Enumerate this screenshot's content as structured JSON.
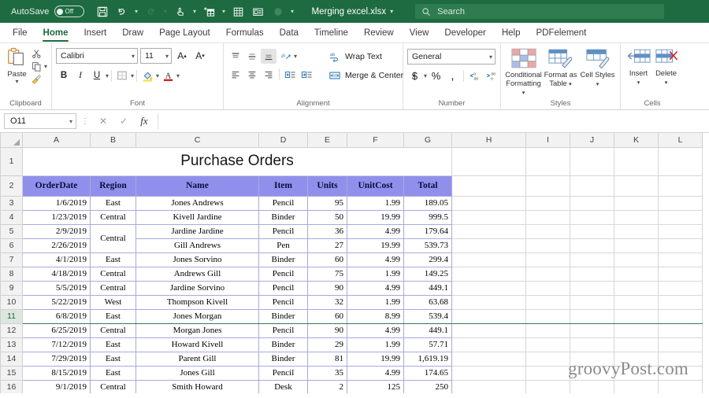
{
  "titlebar": {
    "autosave_label": "AutoSave",
    "autosave_state": "Off",
    "filename": "Merging excel.xlsx",
    "quick_access": [
      {
        "name": "save-icon"
      },
      {
        "name": "undo-icon"
      },
      {
        "name": "redo-icon"
      },
      {
        "name": "touch-mode-icon"
      },
      {
        "name": "new-table-icon"
      },
      {
        "name": "table-grid-icon"
      },
      {
        "name": "card-view-icon"
      },
      {
        "name": "record-icon"
      },
      {
        "name": "customize-toolbar-icon"
      }
    ]
  },
  "search": {
    "placeholder": "Search",
    "icon": "search-icon"
  },
  "tabs": [
    {
      "label": "File",
      "active": false
    },
    {
      "label": "Home",
      "active": true
    },
    {
      "label": "Insert",
      "active": false
    },
    {
      "label": "Draw",
      "active": false
    },
    {
      "label": "Page Layout",
      "active": false
    },
    {
      "label": "Formulas",
      "active": false
    },
    {
      "label": "Data",
      "active": false
    },
    {
      "label": "Timeline",
      "active": false
    },
    {
      "label": "Review",
      "active": false
    },
    {
      "label": "View",
      "active": false
    },
    {
      "label": "Developer",
      "active": false
    },
    {
      "label": "Help",
      "active": false
    },
    {
      "label": "PDFelement",
      "active": false
    }
  ],
  "ribbon": {
    "clipboard": {
      "group_label": "Clipboard",
      "paste_label": "Paste",
      "cut_icon": "scissors-icon",
      "copy_icon": "copy-icon",
      "format_painter_icon": "format-painter-icon"
    },
    "font": {
      "group_label": "Font",
      "font_name": "Calibri",
      "font_size": "11",
      "grow_font": "A",
      "shrink_font": "A",
      "bold": "B",
      "italic": "I",
      "underline": "U",
      "borders_icon": "borders-icon",
      "fill_color_icon": "fill-color-icon",
      "font_color_icon": "font-color-icon"
    },
    "alignment": {
      "group_label": "Alignment",
      "wrap_text_label": "Wrap Text",
      "merge_center_label": "Merge & Center",
      "orientation_icon": "orientation-icon",
      "wrap_text_icon": "wrap-text-icon",
      "merge_center_icon": "merge-center-icon"
    },
    "number": {
      "group_label": "Number",
      "format": "General",
      "currency": "$",
      "percent": "%",
      "comma": ",",
      "increase_decimal_icon": "increase-decimal-icon",
      "decrease_decimal_icon": "decrease-decimal-icon"
    },
    "styles": {
      "group_label": "Styles",
      "conditional_formatting": "Conditional Formatting",
      "format_as_table": "Format as Table",
      "cell_styles": "Cell Styles"
    },
    "cells": {
      "group_label": "Cells",
      "insert": "Insert",
      "delete": "Delete"
    }
  },
  "formula_bar": {
    "name_box": "O11",
    "cancel_icon": "cancel-icon",
    "confirm_icon": "confirm-icon",
    "function_icon": "fx",
    "formula_value": ""
  },
  "grid": {
    "columns": [
      "A",
      "B",
      "C",
      "D",
      "E",
      "F",
      "G",
      "H",
      "I",
      "J",
      "K",
      "L"
    ],
    "rows": [
      "1",
      "2",
      "3",
      "4",
      "5",
      "6",
      "7",
      "8",
      "9",
      "10",
      "11",
      "12",
      "13",
      "14",
      "15",
      "16"
    ],
    "active_row": "11",
    "title": "Purchase Orders",
    "headers": [
      "OrderDate",
      "Region",
      "Name",
      "Item",
      "Units",
      "UnitCost",
      "Total"
    ],
    "header_bg": "#9090EC",
    "data": [
      {
        "row": "3",
        "date": "1/6/2019",
        "region": "East",
        "name": "Jones Andrews",
        "item": "Pencil",
        "units": "95",
        "unitcost": "1.99",
        "total": "189.05"
      },
      {
        "row": "4",
        "date": "1/23/2019",
        "region": "Central",
        "name": "Kivell Jardine",
        "item": "Binder",
        "units": "50",
        "unitcost": "19.99",
        "total": "999.5"
      },
      {
        "row": "5",
        "date": "2/9/2019",
        "region": "Central",
        "name": "Jardine Jardine",
        "item": "Pencil",
        "units": "36",
        "unitcost": "4.99",
        "total": "179.64"
      },
      {
        "row": "6",
        "date": "2/26/2019",
        "region": "",
        "name": "Gill Andrews",
        "item": "Pen",
        "units": "27",
        "unitcost": "19.99",
        "total": "539.73"
      },
      {
        "row": "7",
        "date": "4/1/2019",
        "region": "East",
        "name": "Jones Sorvino",
        "item": "Binder",
        "units": "60",
        "unitcost": "4.99",
        "total": "299.4"
      },
      {
        "row": "8",
        "date": "4/18/2019",
        "region": "Central",
        "name": "Andrews Gill",
        "item": "Pencil",
        "units": "75",
        "unitcost": "1.99",
        "total": "149.25"
      },
      {
        "row": "9",
        "date": "5/5/2019",
        "region": "Central",
        "name": "Jardine Sorvino",
        "item": "Pencil",
        "units": "90",
        "unitcost": "4.99",
        "total": "449.1"
      },
      {
        "row": "10",
        "date": "5/22/2019",
        "region": "West",
        "name": "Thompson Kivell",
        "item": "Pencil",
        "units": "32",
        "unitcost": "1.99",
        "total": "63.68"
      },
      {
        "row": "11",
        "date": "6/8/2019",
        "region": "East",
        "name": "Jones Morgan",
        "item": "Binder",
        "units": "60",
        "unitcost": "8.99",
        "total": "539.4"
      },
      {
        "row": "12",
        "date": "6/25/2019",
        "region": "Central",
        "name": "Morgan Jones",
        "item": "Pencil",
        "units": "90",
        "unitcost": "4.99",
        "total": "449.1"
      },
      {
        "row": "13",
        "date": "7/12/2019",
        "region": "East",
        "name": "Howard Kivell",
        "item": "Binder",
        "units": "29",
        "unitcost": "1.99",
        "total": "57.71"
      },
      {
        "row": "14",
        "date": "7/29/2019",
        "region": "East",
        "name": "Parent Gill",
        "item": "Binder",
        "units": "81",
        "unitcost": "19.99",
        "total": "1,619.19"
      },
      {
        "row": "15",
        "date": "8/15/2019",
        "region": "East",
        "name": "Jones Gill",
        "item": "Pencil",
        "units": "35",
        "unitcost": "4.99",
        "total": "174.65"
      },
      {
        "row": "16",
        "date": "9/1/2019",
        "region": "Central",
        "name": "Smith Howard",
        "item": "Desk",
        "units": "2",
        "unitcost": "125",
        "total": "250"
      }
    ],
    "merged_region_label": "Central"
  },
  "watermark": "groovyPost.com"
}
